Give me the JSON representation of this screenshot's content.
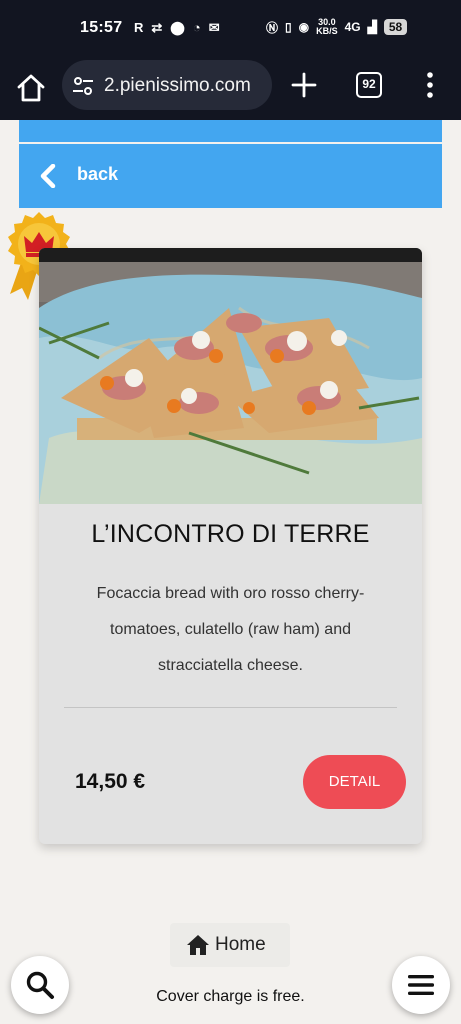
{
  "status_bar": {
    "time": "15:57",
    "left_icons": [
      "R",
      "sync-icon",
      "location-icon",
      "timer-icon",
      "mail-icon"
    ],
    "network_speed_value": "30.0",
    "network_speed_unit": "KB/S",
    "signal_label": "4G",
    "battery": "58"
  },
  "browser": {
    "url": "2.pienissimo.com",
    "tab_count": "92"
  },
  "nav": {
    "back_label": "back"
  },
  "product": {
    "title": "L’INCONTRO DI TERRE",
    "description": "Focaccia bread with oro rosso cherry-tomatoes, culatello (raw ham) and stracciatella cheese.",
    "price": "14,50 €",
    "detail_label": "DETAIL"
  },
  "footer": {
    "home_label": "Home",
    "note": "Cover charge is free."
  },
  "colors": {
    "accent_blue": "#43a6f0",
    "detail_red": "#ee4c55",
    "badge_gold": "#f2b21a"
  }
}
